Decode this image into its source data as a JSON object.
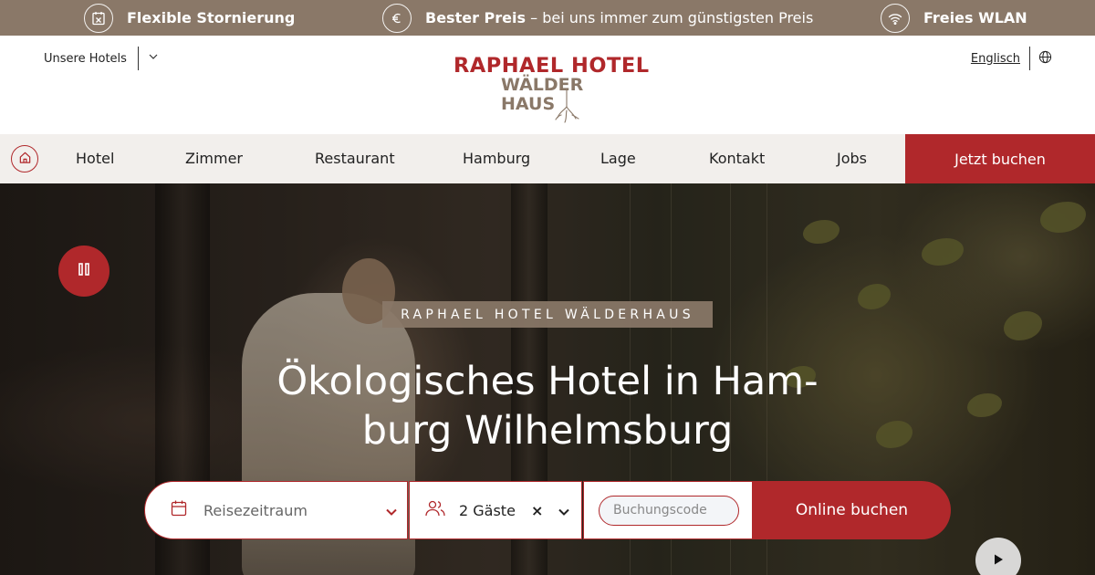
{
  "usp_bar": {
    "items": [
      {
        "icon": "calendar-cancel-icon",
        "bold": "Flexible Stornierung",
        "rest": ""
      },
      {
        "icon": "euro-icon",
        "bold": "Bester Preis",
        "rest": " – bei uns immer zum günstigsten Preis"
      },
      {
        "icon": "wifi-icon",
        "bold": "Freies WLAN",
        "rest": ""
      }
    ],
    "background": "#8a7868"
  },
  "header": {
    "hotels_select": "Unsere Hotels",
    "logo": {
      "line1": "RAPHAEL HOTEL",
      "line2": "WÄLDER\nHAUS"
    },
    "language_link": "Englisch",
    "language_icon": "globe-icon"
  },
  "nav": {
    "home_icon": "home-icon",
    "items": [
      "Hotel",
      "Zimmer",
      "Restaurant",
      "Hamburg",
      "Lage",
      "Kontakt",
      "Jobs"
    ],
    "cta": "Jetzt buchen"
  },
  "hero": {
    "tag": "RAPHAEL HOTEL WÄLDERHAUS",
    "title": "Ökologisches Hotel in Ham-\nburg Wilhelmsburg",
    "pause_icon": "pause-icon",
    "play_icon": "play-icon"
  },
  "booking": {
    "date_label": "Reisezeitraum",
    "guests_label": "2 Gäste",
    "guests_clear": "×",
    "code_placeholder": "Buchungscode",
    "submit": "Online buchen"
  },
  "colors": {
    "brand_red": "#b0282b",
    "brand_brown": "#8a7868",
    "nav_bg": "#f2efec"
  }
}
